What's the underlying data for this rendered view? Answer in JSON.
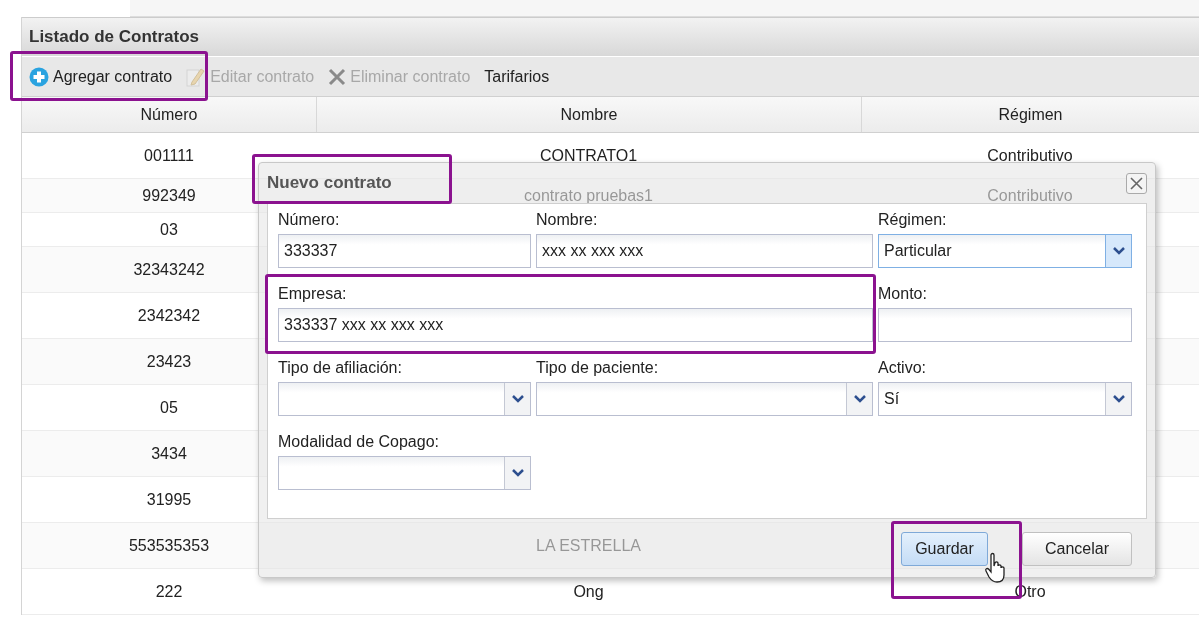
{
  "panel": {
    "title": "Listado de Contratos"
  },
  "toolbar": [
    {
      "label": "Agregar contrato",
      "disabled": false
    },
    {
      "label": "Editar contrato",
      "disabled": true
    },
    {
      "label": "Eliminar contrato",
      "disabled": true
    },
    {
      "label": "Tarifarios",
      "disabled": false
    }
  ],
  "table": {
    "columns": [
      "Número",
      "Nombre",
      "Régimen"
    ],
    "rows": [
      {
        "numero": "001111",
        "nombre": "CONTRATO1",
        "regimen": "Contributivo"
      },
      {
        "numero": "992349",
        "nombre": "contrato pruebas1",
        "regimen": "Contributivo"
      },
      {
        "numero": "03"
      },
      {
        "numero": "32343242"
      },
      {
        "numero": "2342342"
      },
      {
        "numero": "23423"
      },
      {
        "numero": "05"
      },
      {
        "numero": "3434"
      },
      {
        "numero": "31995"
      },
      {
        "numero": "553535353",
        "nombre": "LA ESTRELLA"
      },
      {
        "numero": "222",
        "nombre": "Ong",
        "regimen": "Otro"
      }
    ]
  },
  "dialog": {
    "title": "Nuevo contrato",
    "fields": [
      {
        "kind": "text",
        "label": "Número:",
        "value": "333337"
      },
      {
        "kind": "text",
        "label": "Nombre:",
        "value": "xxx xx xxx xxx"
      },
      {
        "kind": "select",
        "label": "Régimen:",
        "value": "Particular",
        "focused": true
      },
      {
        "kind": "wide_text",
        "label": "Empresa:",
        "value": "333337 xxx xx xxx xxx"
      },
      {
        "kind": "text",
        "label": "Monto:"
      },
      {
        "kind": "select",
        "label": "Tipo de afiliación:",
        "focused": false
      },
      {
        "kind": "select",
        "label": "Tipo de paciente:",
        "focused": false
      },
      {
        "kind": "select",
        "label": "Activo:",
        "value": "Sí",
        "focused": false
      },
      {
        "kind": "select",
        "label": "Modalidad de Copago:",
        "focused": false
      }
    ],
    "buttons": [
      {
        "label": "Guardar",
        "primary": true
      },
      {
        "label": "Cancelar",
        "primary": false
      }
    ]
  }
}
